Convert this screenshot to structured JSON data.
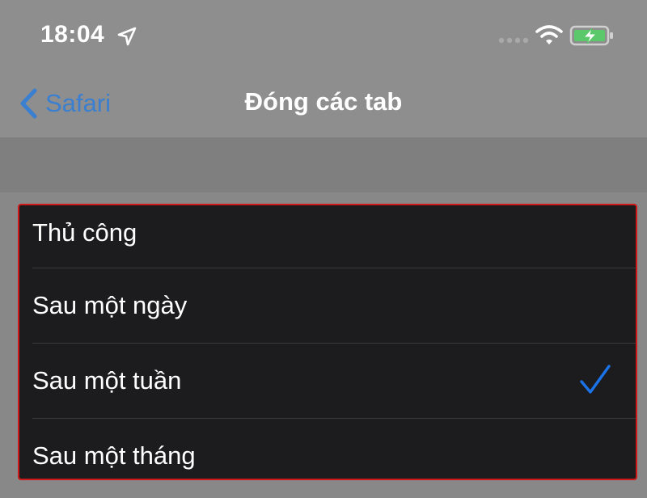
{
  "status_bar": {
    "time": "18:04",
    "icons": [
      "location-icon",
      "signal-icon",
      "wifi-icon",
      "battery-charging-icon"
    ]
  },
  "nav": {
    "back_label": "Safari",
    "title": "Đóng các tab"
  },
  "options": [
    {
      "label": "Thủ công",
      "selected": false
    },
    {
      "label": "Sau một ngày",
      "selected": false
    },
    {
      "label": "Sau một tuần",
      "selected": true
    },
    {
      "label": "Sau một tháng",
      "selected": false
    }
  ],
  "colors": {
    "accent": "#3a7fd0",
    "checkmark": "#1a73e8",
    "highlight_border": "#d01818",
    "battery_fill": "#5cc86c"
  }
}
